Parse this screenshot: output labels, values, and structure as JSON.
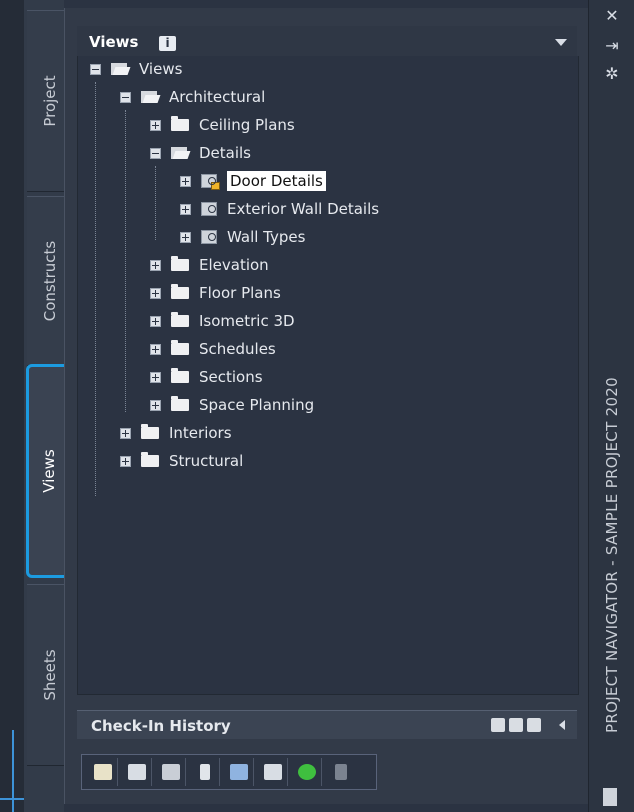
{
  "palette": "Views",
  "tabs": [
    {
      "label": "Project"
    },
    {
      "label": "Constructs"
    },
    {
      "label": "Views"
    },
    {
      "label": "Sheets"
    }
  ],
  "header": {
    "title": "Views",
    "info_icon": "i"
  },
  "tree": {
    "root": "Views",
    "architectural": "Architectural",
    "ceiling_plans": "Ceiling Plans",
    "details": "Details",
    "door_details": "Door Details",
    "exterior_wall_details": "Exterior Wall Details",
    "wall_types": "Wall Types",
    "elevation": "Elevation",
    "floor_plans": "Floor Plans",
    "isometric_3d": "Isometric 3D",
    "schedules": "Schedules",
    "sections": "Sections",
    "space_planning": "Space Planning",
    "interiors": "Interiors",
    "structural": "Structural"
  },
  "checkin": {
    "title": "Check-In History"
  },
  "right_strip": {
    "title": "PROJECT NAVIGATOR - SAMPLE PROJECT 2020",
    "close": "✕",
    "pin": "⇥",
    "settings": "✲"
  },
  "colors": {
    "accent": "#1c9be0",
    "bg": "#2b3342",
    "selected_bg": "#ffffff"
  }
}
